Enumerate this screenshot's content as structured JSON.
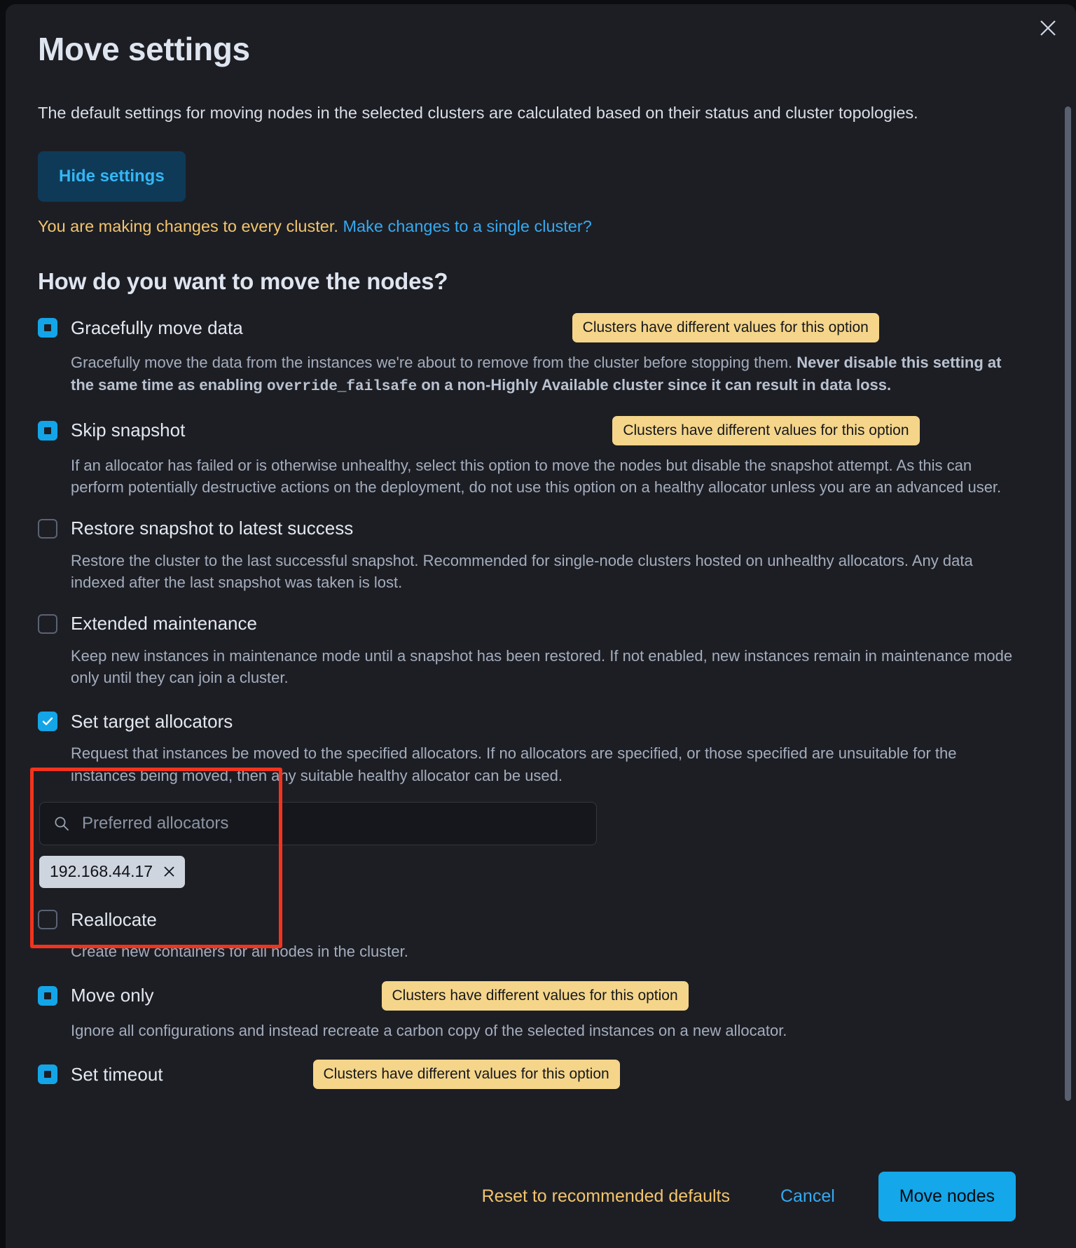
{
  "dialog": {
    "title": "Move settings",
    "intro": "The default settings for moving nodes in the selected clusters are calculated based on their status and cluster topologies.",
    "hide_settings_label": "Hide settings",
    "warning_text": "You are making changes to every cluster.",
    "warning_link": "Make changes to a single cluster?",
    "section_title": "How do you want to move the nodes?",
    "close_icon": "close-icon"
  },
  "badge_text": "Clusters have different values for this option",
  "options": [
    {
      "label": "Gracefully move data",
      "state": "indeterminate",
      "badge": true,
      "desc_plain": "Gracefully move the data from the instances we're about to remove from the cluster before stopping them. ",
      "desc_bold_1": "Never disable this setting at the same time as enabling ",
      "desc_code": "override_failsafe",
      "desc_bold_2": " on a non-Highly Available cluster since it can result in data loss."
    },
    {
      "label": "Skip snapshot",
      "state": "indeterminate",
      "badge": true,
      "desc": "If an allocator has failed or is otherwise unhealthy, select this option to move the nodes but disable the snapshot attempt. As this can perform potentially destructive actions on the deployment, do not use this option on a healthy allocator unless you are an advanced user."
    },
    {
      "label": "Restore snapshot to latest success",
      "state": "unchecked",
      "badge": false,
      "desc": "Restore the cluster to the last successful snapshot. Recommended for single-node clusters hosted on unhealthy allocators. Any data indexed after the last snapshot was taken is lost."
    },
    {
      "label": "Extended maintenance",
      "state": "unchecked",
      "badge": false,
      "desc": "Keep new instances in maintenance mode until a snapshot has been restored. If not enabled, new instances remain in maintenance mode only until they can join a cluster."
    },
    {
      "label": "Set target allocators",
      "state": "checked",
      "badge": false,
      "desc": "Request that instances be moved to the specified allocators. If no allocators are specified, or those specified are unsuitable for the instances being moved, then any suitable healthy allocator can be used."
    },
    {
      "label": "Reallocate",
      "state": "unchecked",
      "badge": false,
      "desc": "Create new containers for all nodes in the cluster."
    },
    {
      "label": "Move only",
      "state": "indeterminate",
      "badge": true,
      "desc": "Ignore all configurations and instead recreate a carbon copy of the selected instances on a new allocator."
    },
    {
      "label": "Set timeout",
      "state": "indeterminate",
      "badge": true,
      "desc": ""
    }
  ],
  "allocators": {
    "placeholder": "Preferred allocators",
    "search_icon": "search-icon",
    "selected": [
      {
        "value": "192.168.44.17",
        "remove_icon": "close-icon"
      }
    ]
  },
  "footer": {
    "reset_label": "Reset to recommended defaults",
    "cancel_label": "Cancel",
    "move_label": "Move nodes"
  },
  "colors": {
    "accent_blue": "#14a7ea",
    "warning_amber": "#f2c46d",
    "badge_bg": "#f5d58a",
    "highlight_red": "#f4331d",
    "modal_bg": "#1d1e24"
  }
}
